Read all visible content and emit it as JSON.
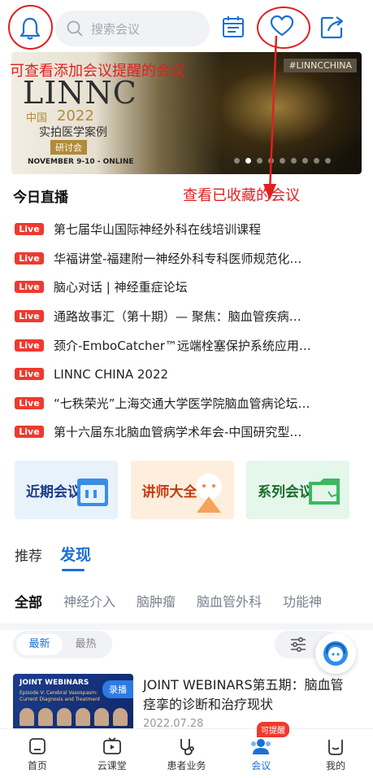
{
  "header": {
    "search_placeholder": "搜索会议",
    "annotation_reminder": "可查看添加会议提醒的会议",
    "annotation_favorites": "查看已收藏的会议"
  },
  "banner": {
    "tag": "#LINNCCHINA",
    "logo": "LINNC",
    "cn": "中国",
    "year": "2022",
    "subtitle": "实拍医学案例",
    "subtitle2": "研讨会",
    "date": "NOVEMBER 9-10 - ONLINE",
    "slides": 9,
    "active_slide": 1
  },
  "today_live": {
    "title": "今日直播",
    "badge": "Live",
    "items": [
      "第七届华山国际神经外科在线培训课程",
      "华福讲堂-福建附一神经外科专科医师规范化…",
      "脑心对话 | 神经重症论坛",
      "通路故事汇（第十期）— 聚焦：脑血管疾病…",
      "颈介-EmboCatcher™远端栓塞保护系统应用…",
      "LINNC CHINA 2022",
      "“七秩荣光”上海交通大学医学院脑血管病论坛…",
      "第十六届东北脑血管病学术年会-中国研究型…"
    ]
  },
  "cards": {
    "recent": "近期会议",
    "speakers": "讲师大全",
    "series": "系列会议"
  },
  "tabs": {
    "recommend": "推荐",
    "discover": "发现"
  },
  "categories": [
    "全部",
    "神经介入",
    "脑肿瘤",
    "脑血管外科",
    "功能神"
  ],
  "sort": {
    "latest": "最新",
    "hottest": "最热"
  },
  "meeting": {
    "thumb_title": "JOINT WEBINARS",
    "thumb_sub": "Episode V: Cerebral Vasospasm: Current Diagnosis and Treatment",
    "record_label": "录播",
    "title": "JOINT WEBINARS第五期：脑血管痉挛的诊断和治疗现状",
    "date": "2022.07.28"
  },
  "bottom_nav": {
    "home": "首页",
    "cloud": "云课堂",
    "patient": "患者业务",
    "meeting": "会议",
    "mine": "我的",
    "remind_badge": "可提醒"
  },
  "colors": {
    "accent": "#1a6fd6",
    "live": "#f0392f",
    "annotation": "#e02020"
  }
}
